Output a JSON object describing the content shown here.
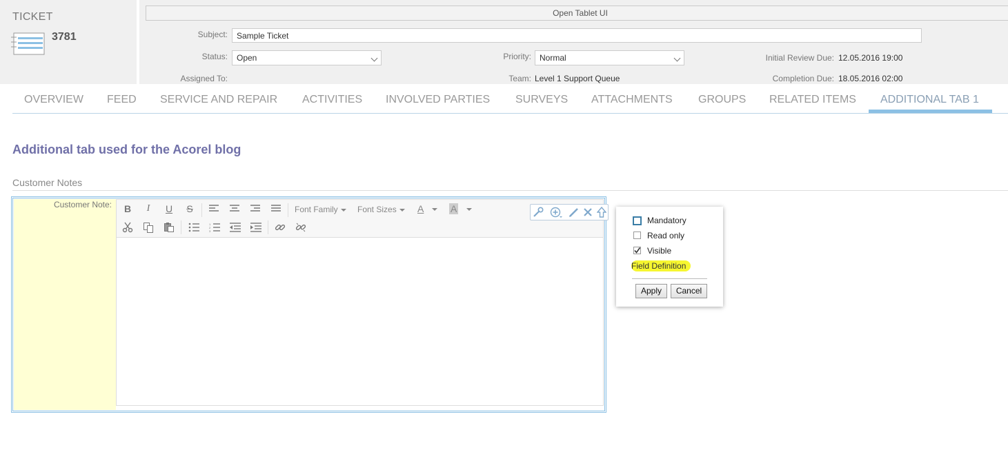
{
  "ticket": {
    "label": "TICKET",
    "number": "3781"
  },
  "header": {
    "open_tablet_ui": "Open Tablet UI",
    "subject_label": "Subject:",
    "subject_value": "Sample Ticket",
    "status_label": "Status:",
    "status_value": "Open",
    "priority_label": "Priority:",
    "priority_value": "Normal",
    "initial_review_label": "Initial Review Due:",
    "initial_review_value": "12.05.2016 19:00",
    "assigned_label": "Assigned To:",
    "team_label": "Team:",
    "team_value": "Level 1 Support Queue",
    "completion_label": "Completion Due:",
    "completion_value": "18.05.2016 02:00"
  },
  "tabs": [
    {
      "label": "OVERVIEW"
    },
    {
      "label": "FEED"
    },
    {
      "label": "SERVICE AND REPAIR"
    },
    {
      "label": "ACTIVITIES"
    },
    {
      "label": "INVOLVED PARTIES"
    },
    {
      "label": "SURVEYS"
    },
    {
      "label": "ATTACHMENTS"
    },
    {
      "label": "GROUPS"
    },
    {
      "label": "RELATED ITEMS"
    },
    {
      "label": "ADDITIONAL TAB 1"
    }
  ],
  "active_tab": "ADDITIONAL TAB 1",
  "main": {
    "title": "Additional tab used for the Acorel blog",
    "section_header": "Customer Notes",
    "field_label": "Customer Note:"
  },
  "editor": {
    "font_family_label": "Font Family",
    "font_sizes_label": "Font Sizes",
    "font_color_glyph": "A",
    "highlight_glyph": "A"
  },
  "popup": {
    "mandatory_label": "Mandatory",
    "readonly_label": "Read only",
    "visible_label": "Visible",
    "mandatory_checked": false,
    "readonly_checked": false,
    "visible_checked": true,
    "field_definition_label": "Field Definition",
    "apply_label": "Apply",
    "cancel_label": "Cancel"
  },
  "colors": {
    "accent": "#8cc0e4",
    "title": "#7070a8",
    "label_bg": "#ffffd4",
    "highlight": "#f6f630"
  }
}
